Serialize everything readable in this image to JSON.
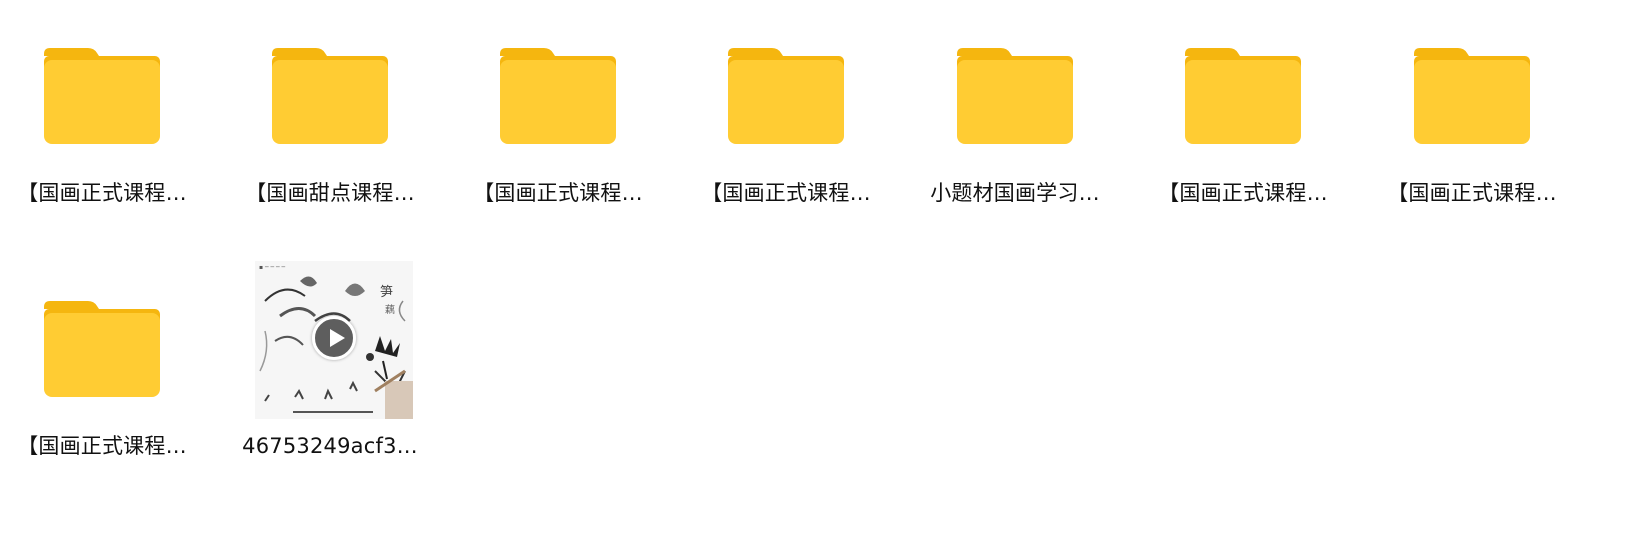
{
  "items": [
    {
      "type": "folder",
      "label": "【国画正式课程…"
    },
    {
      "type": "folder",
      "label": "【国画甜点课程…"
    },
    {
      "type": "folder",
      "label": "【国画正式课程…"
    },
    {
      "type": "folder",
      "label": "【国画正式课程…"
    },
    {
      "type": "folder",
      "label": "小题材国画学习…"
    },
    {
      "type": "folder",
      "label": "【国画正式课程…"
    },
    {
      "type": "folder",
      "label": "【国画正式课程…"
    },
    {
      "type": "folder",
      "label": "【国画正式课程…"
    },
    {
      "type": "video",
      "label": "46753249acf3…",
      "icon": "play-icon"
    }
  ],
  "colors": {
    "folder_body": "#FFCC33",
    "folder_tab": "#F5B60F",
    "label_text": "#111111",
    "background": "#FFFFFF"
  }
}
